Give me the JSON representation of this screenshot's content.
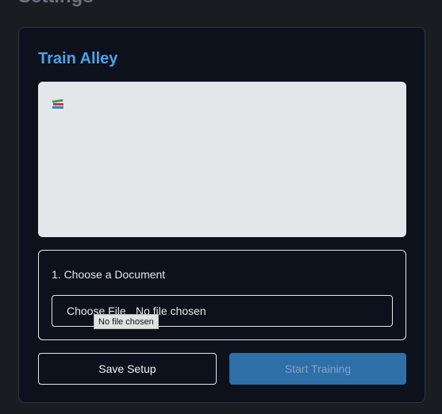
{
  "page": {
    "heading": "Settings"
  },
  "card": {
    "title": "Train Alley",
    "preview": {
      "icon": "books-icon"
    },
    "step1": {
      "label": "1. Choose a Document",
      "file_button_label": "Choose File",
      "file_status": "No file chosen",
      "tooltip": "No file chosen"
    },
    "actions": {
      "save_label": "Save Setup",
      "start_label": "Start Training",
      "start_disabled": true
    }
  },
  "colors": {
    "background": "#1a1c22",
    "card": "#0c111b",
    "accent": "#4aa3e8",
    "primary_button": "#2f6fa8",
    "preview_panel": "#e5e6ea"
  }
}
